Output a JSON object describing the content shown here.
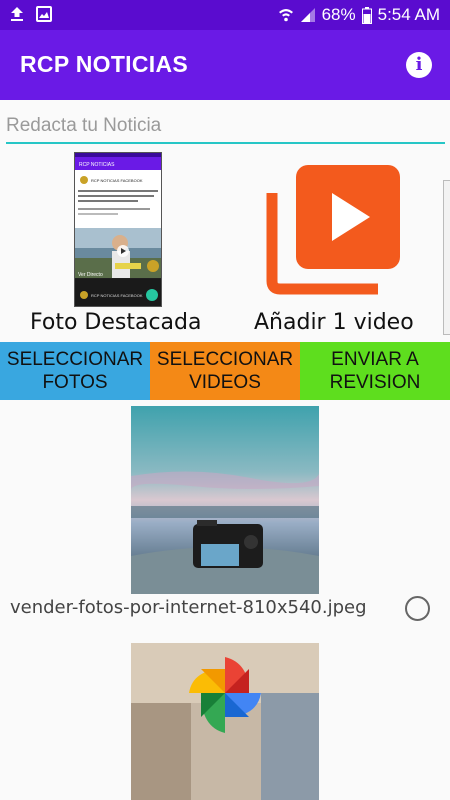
{
  "status_bar": {
    "battery": "68%",
    "time": "5:54 AM"
  },
  "app_bar": {
    "title": "RCP NOTICIAS",
    "info_icon": "info-icon"
  },
  "news_input": {
    "placeholder": "Redacta tu Noticia",
    "value": ""
  },
  "media_pickers": {
    "photo_caption": "Foto Destacada",
    "video_caption": "Añadir 1 video",
    "thumbnail": {
      "app_title": "RCP NOTICIAS",
      "post_title": "RCP NOTICIAS FACEBOOK",
      "headline": "EL PRIMER DIPUTADO QUE SE METE A EL QUE SE REPITE ES COMO REGRESAR",
      "footer_title": "RCP NOTICIAS FACEBOOK",
      "live_label": "Ver Directo"
    }
  },
  "actions": {
    "select_photos": "SELECCIONAR\nFOTOS",
    "select_videos": "SELECCIONAR\nVIDEOS",
    "send_review": "ENVIAR A\nREVISION"
  },
  "attachments": [
    {
      "filename": "vender-fotos-por-internet-810x540.jpeg",
      "selected": false
    }
  ],
  "colors": {
    "status_bar": "#5a0ccf",
    "app_bar": "#6a1ae6",
    "input_underline": "#26c6c6",
    "btn_fotos": "#39a7e0",
    "btn_videos": "#f48916",
    "btn_enviar": "#5ede1e",
    "video_icon": "#f35a1d"
  }
}
